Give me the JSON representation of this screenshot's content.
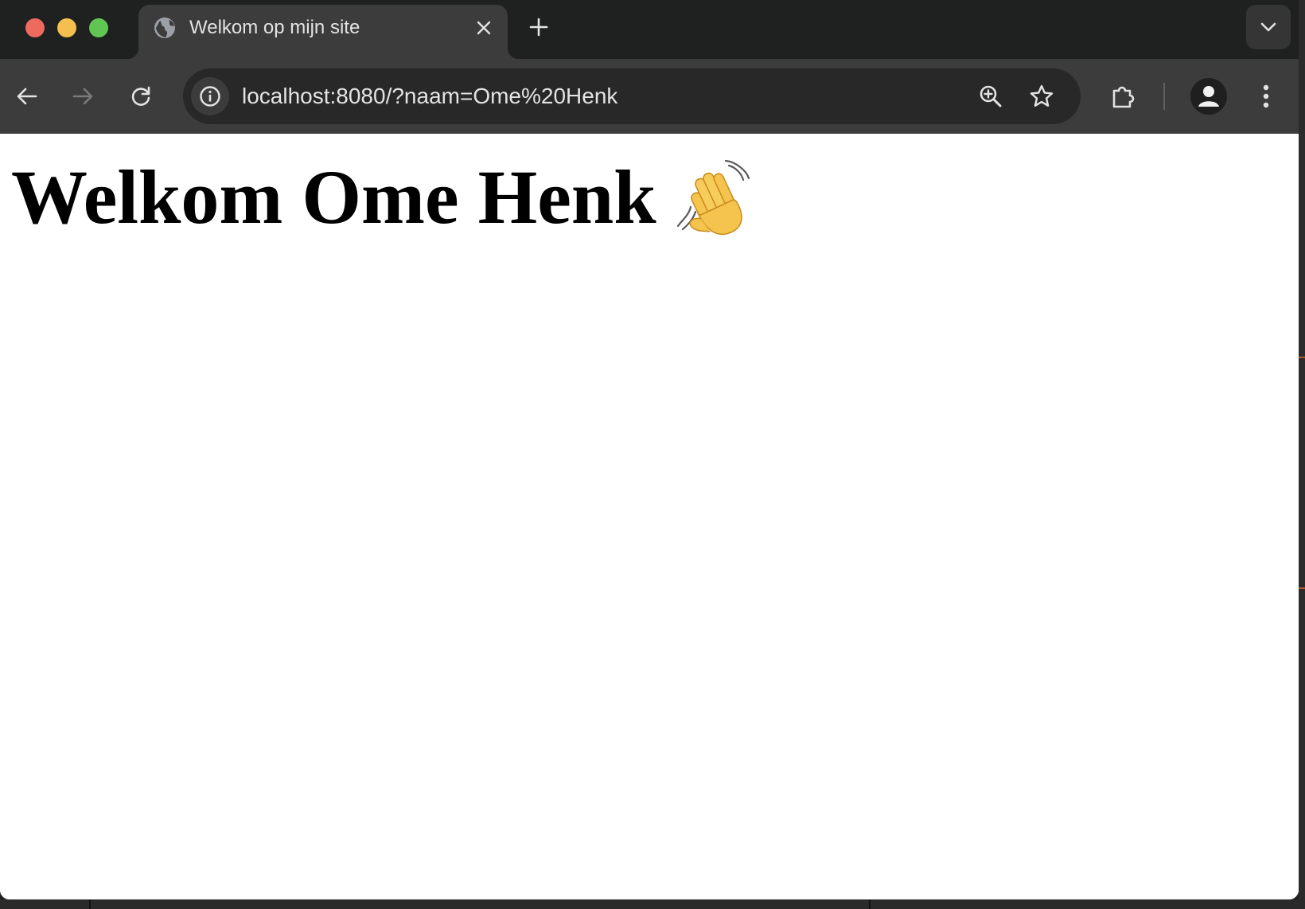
{
  "browser": {
    "tab": {
      "title": "Welkom op mijn site",
      "favicon": "globe-icon"
    },
    "toolbar": {
      "url": "localhost:8080/?naam=Ome%20Henk",
      "back_enabled": true,
      "forward_enabled": false
    },
    "icons": {
      "close": "close-icon",
      "new_tab": "plus-icon",
      "tab_search": "chevron-down-icon",
      "back": "back-arrow-icon",
      "forward": "forward-arrow-icon",
      "reload": "reload-icon",
      "site_info": "info-icon",
      "zoom": "zoom-in-icon",
      "bookmark": "star-icon",
      "extensions": "puzzle-icon",
      "profile": "profile-icon",
      "menu": "more-vert-icon"
    }
  },
  "page": {
    "heading": "Welkom Ome Henk",
    "emoji": "waving-hand-icon"
  },
  "colors": {
    "tabbar": "#1f2020",
    "toolbar": "#3c3c3c",
    "omnibox": "#282828",
    "traffic_red": "#ed6a5e",
    "traffic_yellow": "#f5bf4f",
    "traffic_green": "#61c554"
  }
}
